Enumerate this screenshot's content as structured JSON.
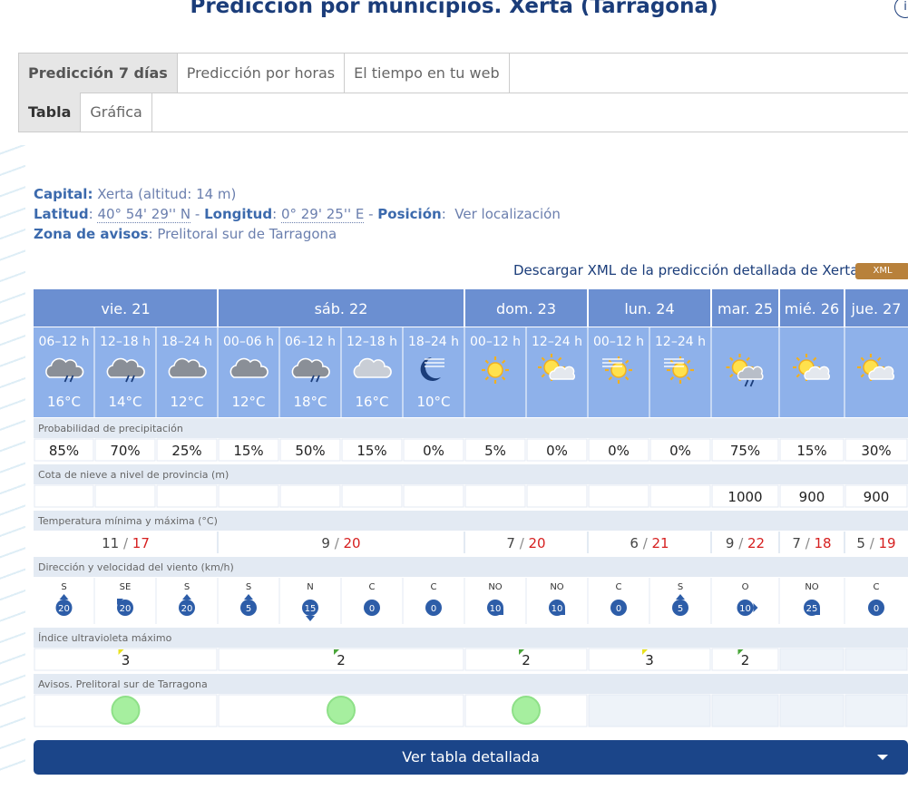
{
  "page_title": "Predicción por municipios. Xerta (Tarragona)",
  "info_glyph": "i",
  "tabs": [
    "Predicción 7 días",
    "Predicción por horas",
    "El tiempo en tu web"
  ],
  "subtabs": [
    "Tabla",
    "Gráfica"
  ],
  "meta": {
    "capital_label": "Capital:",
    "capital_value": "Xerta (altitud: 14 m)",
    "lat_label": "Latitud",
    "lat_value": "40° 54' 29'' N",
    "lon_label": "Longitud",
    "lon_value": "0° 29' 25'' E",
    "pos_label": "Posición",
    "pos_value": "Ver localización",
    "zona_label": "Zona de avisos",
    "zona_value": "Prelitoral sur de Tarragona",
    "dash": "-",
    "colon": ":"
  },
  "xml_text": "Descargar XML de la predicción detallada de Xerta",
  "xml_badge": "XML",
  "days": [
    {
      "label": "vie. 21",
      "cols": 3
    },
    {
      "label": "sáb. 22",
      "cols": 4
    },
    {
      "label": "dom. 23",
      "cols": 2
    },
    {
      "label": "lun. 24",
      "cols": 2
    },
    {
      "label": "mar. 25",
      "cols": 1
    },
    {
      "label": "mié. 26",
      "cols": 1
    },
    {
      "label": "jue. 27",
      "cols": 1
    }
  ],
  "periods": [
    {
      "label": "06–12 h",
      "icon": "rain-cloud-icon",
      "temp": "16°C"
    },
    {
      "label": "12–18 h",
      "icon": "rain-cloud-icon",
      "temp": "14°C"
    },
    {
      "label": "18–24 h",
      "icon": "cloud-icon",
      "temp": "12°C"
    },
    {
      "label": "00–06 h",
      "icon": "cloud-icon",
      "temp": "12°C"
    },
    {
      "label": "06–12 h",
      "icon": "rain-cloud-icon",
      "temp": "18°C"
    },
    {
      "label": "12–18 h",
      "icon": "light-cloud-icon",
      "temp": "16°C"
    },
    {
      "label": "18–24 h",
      "icon": "moon-haze-icon",
      "temp": "10°C"
    },
    {
      "label": "00–12 h",
      "icon": "sun-icon",
      "temp": ""
    },
    {
      "label": "12–24 h",
      "icon": "sun-cloud-icon",
      "temp": ""
    },
    {
      "label": "00–12 h",
      "icon": "sun-haze-icon",
      "temp": ""
    },
    {
      "label": "12–24 h",
      "icon": "sun-haze-icon",
      "temp": ""
    },
    {
      "label": "",
      "icon": "sun-rain-icon",
      "temp": ""
    },
    {
      "label": "",
      "icon": "sun-cloud-icon",
      "temp": ""
    },
    {
      "label": "",
      "icon": "sun-cloud-icon",
      "temp": ""
    }
  ],
  "sections": {
    "precip": "Probabilidad de precipitación",
    "snow": "Cota de nieve a nivel de provincia (m)",
    "temp": "Temperatura mínima y máxima (°C)",
    "wind": "Dirección y velocidad del viento (km/h)",
    "uv": "Índice ultravioleta máximo",
    "alerts": "Avisos. Prelitoral sur de Tarragona"
  },
  "precip": [
    "85%",
    "70%",
    "25%",
    "15%",
    "50%",
    "15%",
    "0%",
    "5%",
    "0%",
    "0%",
    "0%",
    "75%",
    "15%",
    "30%"
  ],
  "snow": [
    "",
    "",
    "",
    "",
    "",
    "",
    "",
    "",
    "",
    "",
    "",
    "1000",
    "900",
    "900"
  ],
  "temps": [
    {
      "min": "11",
      "max": "17"
    },
    {
      "min": "9",
      "max": "20"
    },
    {
      "min": "7",
      "max": "20"
    },
    {
      "min": "6",
      "max": "21"
    },
    {
      "min": "9",
      "max": "22"
    },
    {
      "min": "7",
      "max": "18"
    },
    {
      "min": "5",
      "max": "19"
    }
  ],
  "temp_sep": "/",
  "wind": [
    {
      "dir": "S",
      "speed": "20"
    },
    {
      "dir": "SE",
      "speed": "20"
    },
    {
      "dir": "S",
      "speed": "20"
    },
    {
      "dir": "S",
      "speed": "5"
    },
    {
      "dir": "N",
      "speed": "15"
    },
    {
      "dir": "C",
      "speed": "0"
    },
    {
      "dir": "C",
      "speed": "0"
    },
    {
      "dir": "NO",
      "speed": "10"
    },
    {
      "dir": "NO",
      "speed": "10"
    },
    {
      "dir": "C",
      "speed": "0"
    },
    {
      "dir": "S",
      "speed": "5"
    },
    {
      "dir": "O",
      "speed": "10"
    },
    {
      "dir": "NO",
      "speed": "25"
    },
    {
      "dir": "C",
      "speed": "0"
    }
  ],
  "uv": [
    {
      "value": "3",
      "flag": "yellow"
    },
    {
      "value": "2",
      "flag": "green"
    },
    {
      "value": "2",
      "flag": "green"
    },
    {
      "value": "3",
      "flag": "yellow"
    },
    {
      "value": "2",
      "flag": "green"
    },
    {
      "value": "",
      "flag": ""
    },
    {
      "value": "",
      "flag": ""
    }
  ],
  "alerts": [
    "green",
    "green",
    "green",
    "",
    "",
    "",
    ""
  ],
  "colors": {
    "header": "#6b8fd1",
    "period": "#8eb1ea",
    "band": "#e3eaf3",
    "green_alert": "#a6ef9f",
    "uv_yellow": "#e9e21f",
    "uv_green": "#4aa63a",
    "max_red": "#d61f1f",
    "wind_badge": "#2d5da8"
  },
  "button_label": "Ver tabla detallada"
}
